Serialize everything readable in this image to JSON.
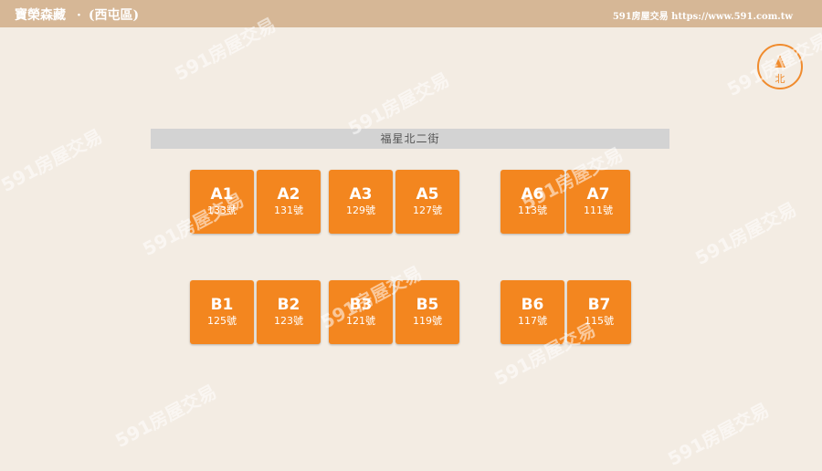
{
  "header": {
    "title": "寶榮森藏",
    "separator": "·",
    "district": "(西屯區)",
    "site": "591房屋交易 https://www.591.com.tw"
  },
  "compass": {
    "label": "北"
  },
  "street": {
    "name": "福星北二街"
  },
  "units": [
    {
      "code": "A1",
      "number": "133號"
    },
    {
      "code": "A2",
      "number": "131號"
    },
    {
      "code": "A3",
      "number": "129號"
    },
    {
      "code": "A5",
      "number": "127號"
    },
    {
      "code": "A6",
      "number": "113號"
    },
    {
      "code": "A7",
      "number": "111號"
    },
    {
      "code": "B1",
      "number": "125號"
    },
    {
      "code": "B2",
      "number": "123號"
    },
    {
      "code": "B3",
      "number": "121號"
    },
    {
      "code": "B5",
      "number": "119號"
    },
    {
      "code": "B6",
      "number": "117號"
    },
    {
      "code": "B7",
      "number": "115號"
    }
  ],
  "watermark": "591房屋交易"
}
